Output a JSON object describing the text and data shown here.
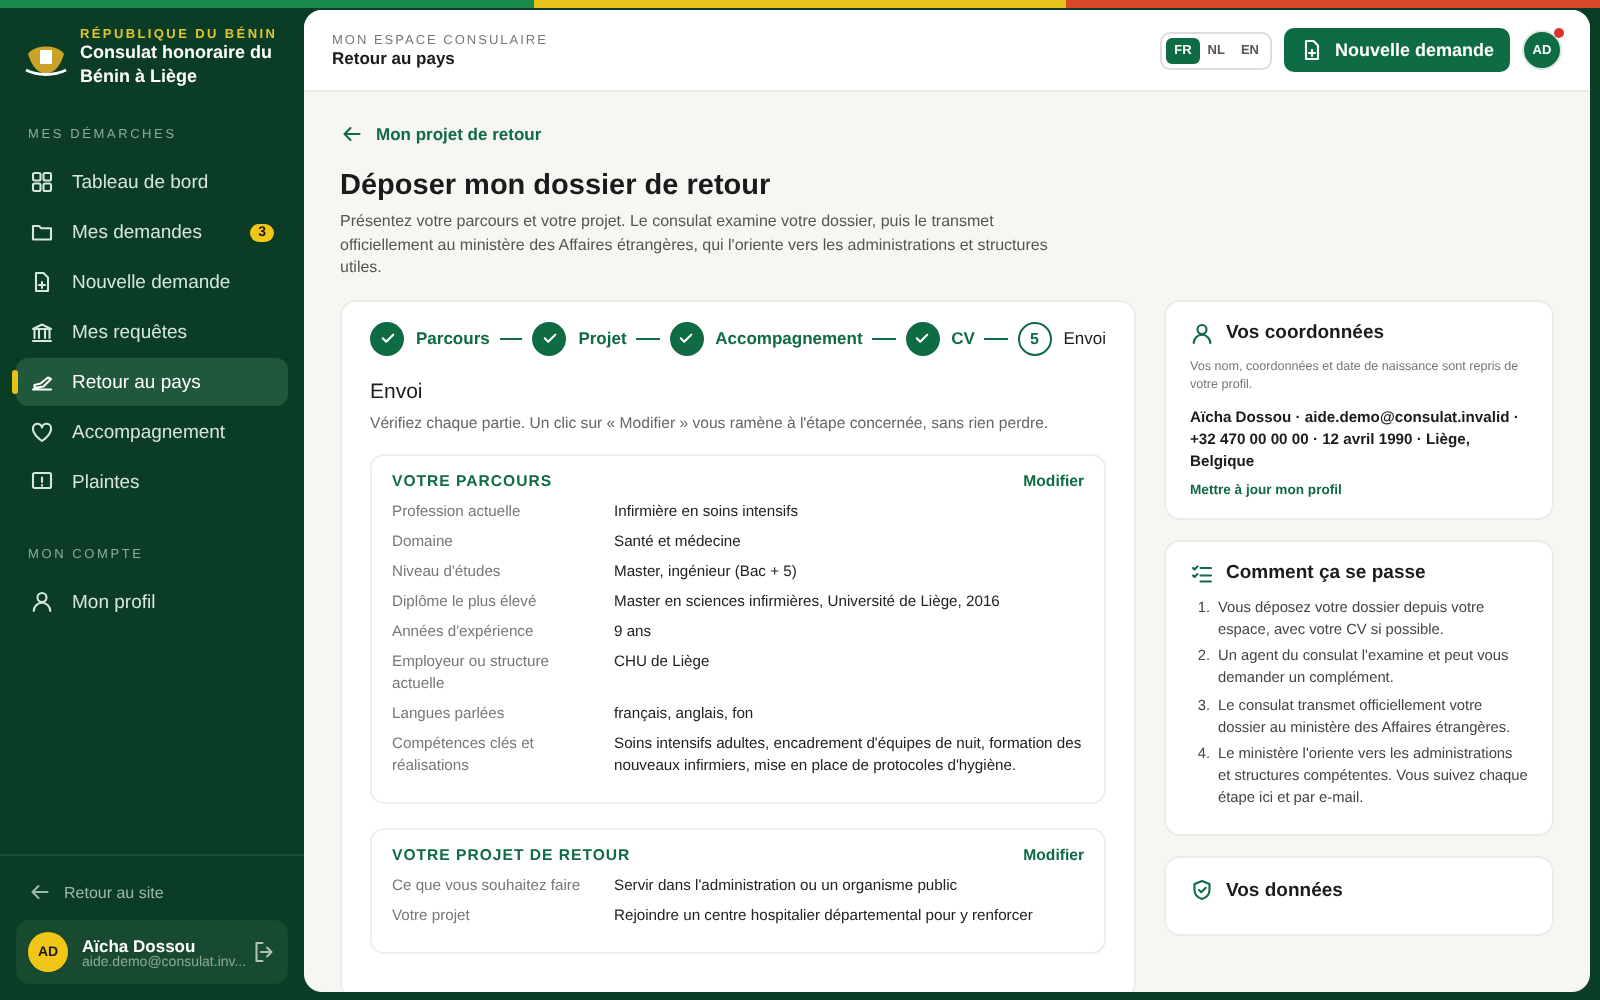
{
  "sidebar": {
    "brand": {
      "country": "RÉPUBLIQUE DU BÉNIN",
      "name": "Consulat honoraire du Bénin à Liège"
    },
    "sections": [
      {
        "heading": "MES DÉMARCHES",
        "items": [
          {
            "label": "Tableau de bord",
            "selected": false
          },
          {
            "label": "Mes demandes",
            "selected": false,
            "badge": "3"
          },
          {
            "label": "Nouvelle demande",
            "selected": false
          },
          {
            "label": "Mes requêtes",
            "selected": false
          },
          {
            "label": "Retour au pays",
            "selected": true
          },
          {
            "label": "Accompagnement",
            "selected": false
          },
          {
            "label": "Plaintes",
            "selected": false
          }
        ]
      },
      {
        "heading": "MON COMPTE",
        "items": [
          {
            "label": "Mon profil",
            "selected": false
          }
        ]
      }
    ],
    "back_link": "Retour au site",
    "user": {
      "initials": "AD",
      "name": "Aïcha Dossou",
      "email": "aide.demo@consulat.inv..."
    }
  },
  "header": {
    "eyebrow": "MON ESPACE CONSULAIRE",
    "title": "Retour au pays",
    "languages": [
      {
        "label": "FR",
        "selected": true
      },
      {
        "label": "NL",
        "selected": false
      },
      {
        "label": "EN",
        "selected": false
      }
    ],
    "new_request_button": "Nouvelle demande",
    "avatar": {
      "initials": "AD",
      "notification": true
    }
  },
  "page": {
    "back_link": "Mon projet de retour",
    "title": "Déposer mon dossier de retour",
    "intro": "Présentez votre parcours et votre projet. Le consulat examine votre dossier, puis le transmet officiellement au ministère des Affaires étrangères, qui l'oriente vers les administrations et structures utiles."
  },
  "stepper": {
    "steps": [
      {
        "label": "Parcours",
        "done": true
      },
      {
        "label": "Projet",
        "done": true
      },
      {
        "label": "Accompagnement",
        "done": true
      },
      {
        "label": "CV",
        "done": true
      },
      {
        "label": "Envoi",
        "done": false,
        "number": "5"
      }
    ],
    "step_title": "Envoi",
    "step_hint": "Vérifiez chaque partie. Un clic sur « Modifier » vous ramène à l'étape concernée, sans rien perdre."
  },
  "review_sections": [
    {
      "title": "VOTRE PARCOURS",
      "action": "Modifier",
      "rows": [
        {
          "label": "Profession actuelle",
          "value": "Infirmière en soins intensifs"
        },
        {
          "label": "Domaine",
          "value": "Santé et médecine"
        },
        {
          "label": "Niveau d'études",
          "value": "Master, ingénieur (Bac + 5)"
        },
        {
          "label": "Diplôme le plus élevé",
          "value": "Master en sciences infirmières, Université de Liège, 2016"
        },
        {
          "label": "Années d'expérience",
          "value": "9 ans"
        },
        {
          "label": "Employeur ou structure actuelle",
          "value": "CHU de Liège"
        },
        {
          "label": "Langues parlées",
          "value": "français, anglais, fon"
        },
        {
          "label": "Compétences clés et réalisations",
          "value": "Soins intensifs adultes, encadrement d'équipes de nuit, formation des nouveaux infirmiers, mise en place de protocoles d'hygiène."
        }
      ]
    },
    {
      "title": "VOTRE PROJET DE RETOUR",
      "action": "Modifier",
      "rows": [
        {
          "label": "Ce que vous souhaitez faire",
          "value": "Servir dans l'administration ou un organisme public"
        },
        {
          "label": "Votre projet",
          "value": "Rejoindre un centre hospitalier départemental pour y renforcer"
        }
      ]
    }
  ],
  "contact_card": {
    "title": "Vos coordonnées",
    "note": "Vos nom, coordonnées et date de naissance sont repris de votre profil.",
    "details": "Aïcha Dossou · aide.demo@consulat.invalid · +32 470 00 00 00 · 12 avril 1990 · Liège, Belgique",
    "link": "Mettre à jour mon profil"
  },
  "process_card": {
    "title": "Comment ça se passe",
    "steps": [
      {
        "number": "1.",
        "text": "Vous déposez votre dossier depuis votre espace, avec votre CV si possible."
      },
      {
        "number": "2.",
        "text": "Un agent du consulat l'examine et peut vous demander un complément."
      },
      {
        "number": "3.",
        "text": "Le consulat transmet officiellement votre dossier au ministère des Affaires étrangères."
      },
      {
        "number": "4.",
        "text": "Le ministère l'oriente vers les administrations et structures compétentes. Vous suivez chaque étape ici et par e-mail."
      }
    ]
  },
  "data_card": {
    "title": "Vos données"
  }
}
